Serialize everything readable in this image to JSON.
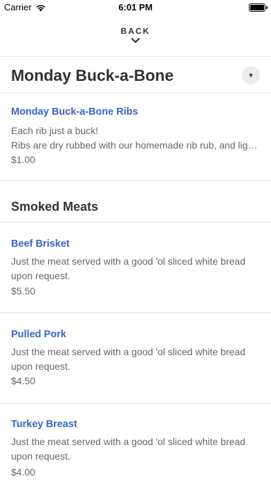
{
  "status_bar": {
    "carrier": "Carrier",
    "time": "6:01 PM"
  },
  "nav": {
    "back_label": "BACK"
  },
  "menu": {
    "title": "Monday Buck-a-Bone"
  },
  "items": [
    {
      "name": "Monday Buck-a-Bone Ribs",
      "desc_lines": [
        "Each rib just a buck!",
        "Ribs are dry rubbed with our homemade rib rub, and ligh…"
      ],
      "price": "$1.00"
    }
  ],
  "section": {
    "title": "Smoked Meats"
  },
  "section_items": [
    {
      "name": "Beef Brisket",
      "desc_lines": [
        "Just the meat served with a good 'ol sliced white bread",
        "upon request."
      ],
      "price": "$5.50"
    },
    {
      "name": "Pulled Pork",
      "desc_lines": [
        "Just the meat served with a good 'ol sliced white bread",
        "upon request."
      ],
      "price": "$4.50"
    },
    {
      "name": "Turkey Breast",
      "desc_lines": [
        "Just the meat served with a good 'ol sliced white bread",
        "upon request."
      ],
      "price": "$4.00"
    }
  ]
}
